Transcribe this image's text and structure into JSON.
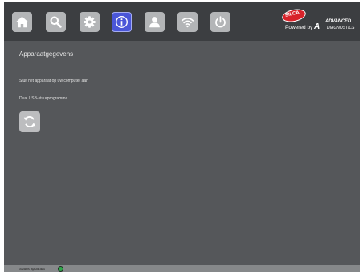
{
  "toolbar": {
    "buttons": [
      {
        "name": "home",
        "icon": "home-icon"
      },
      {
        "name": "search",
        "icon": "search-icon"
      },
      {
        "name": "settings",
        "icon": "gear-icon"
      },
      {
        "name": "info",
        "icon": "info-icon",
        "active": true
      },
      {
        "name": "user",
        "icon": "user-icon"
      },
      {
        "name": "wifi",
        "icon": "wifi-icon"
      },
      {
        "name": "power",
        "icon": "power-icon"
      }
    ],
    "active_color": "#4a56d8",
    "button_color": "#b3b5b7"
  },
  "logo": {
    "brand": "SILCA",
    "powered_by": "Powered by",
    "company_line1": "ADVANCED",
    "company_line2": "DIAGNOSTICS"
  },
  "main": {
    "title": "Apparaatgegevens",
    "lines": [
      "Sluit het apparaat op uw computer aan",
      "Dual USB-stuurprogramma"
    ],
    "refresh_icon": "refresh-icon"
  },
  "statusbar": {
    "label": "Status apparaat",
    "status_color": "#2ea84a"
  }
}
